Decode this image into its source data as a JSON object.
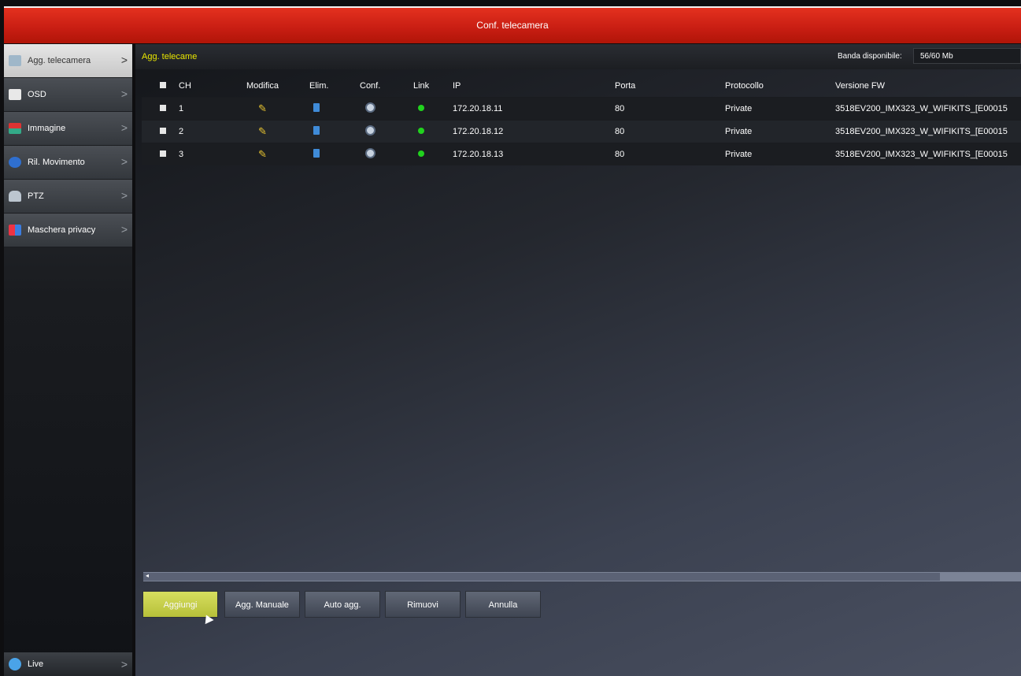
{
  "window": {
    "title": "Conf. telecamera"
  },
  "sidebar": {
    "items": [
      {
        "label": "Agg. telecamera",
        "icon": "camera-icon",
        "active": true
      },
      {
        "label": "OSD",
        "icon": "osd-icon",
        "active": false
      },
      {
        "label": "Immagine",
        "icon": "image-icon",
        "active": false
      },
      {
        "label": "Ril. Movimento",
        "icon": "motion-icon",
        "active": false
      },
      {
        "label": "PTZ",
        "icon": "ptz-icon",
        "active": false
      },
      {
        "label": "Maschera privacy",
        "icon": "privacy-mask-icon",
        "active": false
      }
    ],
    "live": {
      "label": "Live",
      "icon": "live-icon"
    }
  },
  "main": {
    "title": "Agg. telecame",
    "bandwidth_label": "Banda disponibile:",
    "bandwidth_value": "56/60 Mb",
    "columns": [
      "CH",
      "Modifica",
      "Elim.",
      "Conf.",
      "Link",
      "IP",
      "Porta",
      "Protocollo",
      "Versione FW"
    ],
    "rows": [
      {
        "ch": "1",
        "ip": "172.20.18.11",
        "port": "80",
        "protocol": "Private",
        "fw": "3518EV200_IMX323_W_WIFIKITS_[E00015"
      },
      {
        "ch": "2",
        "ip": "172.20.18.12",
        "port": "80",
        "protocol": "Private",
        "fw": "3518EV200_IMX323_W_WIFIKITS_[E00015"
      },
      {
        "ch": "3",
        "ip": "172.20.18.13",
        "port": "80",
        "protocol": "Private",
        "fw": "3518EV200_IMX323_W_WIFIKITS_[E00015"
      }
    ],
    "buttons": {
      "add": "Aggiungi",
      "manual_add": "Agg. Manuale",
      "auto_add": "Auto agg.",
      "remove": "Rimuovi",
      "cancel": "Annulla"
    }
  },
  "colors": {
    "title_bar": "#d42617",
    "accent_yellow": "#e9e600",
    "link_ok": "#21d21e"
  }
}
